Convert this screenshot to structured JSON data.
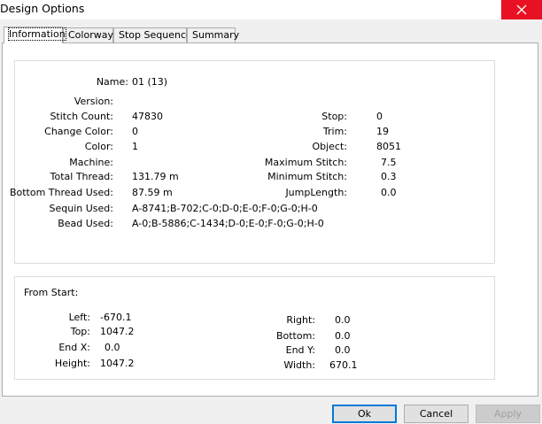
{
  "window": {
    "title": "Design Options"
  },
  "tabs": [
    "Information",
    "Colorway",
    "Stop Sequence",
    "Summary"
  ],
  "info": {
    "name_label": "Name:",
    "name": "01 (13)",
    "version_label": "Version:",
    "version": "",
    "stitch_count_label": "Stitch Count:",
    "stitch_count": "47830",
    "change_color_label": "Change Color:",
    "change_color": "0",
    "color_label": "Color:",
    "color": "1",
    "machine_label": "Machine:",
    "machine": "",
    "total_thread_label": "Total Thread:",
    "total_thread": "131.79 m",
    "bottom_thread_label": "Bottom Thread Used:",
    "bottom_thread": "87.59 m",
    "sequin_label": "Sequin Used:",
    "sequin": "A-8741;B-702;C-0;D-0;E-0;F-0;G-0;H-0",
    "bead_label": "Bead Used:",
    "bead": "A-0;B-5886;C-1434;D-0;E-0;F-0;G-0;H-0",
    "stop_label": "Stop:",
    "stop": "0",
    "trim_label": "Trim:",
    "trim": "19",
    "object_label": "Object:",
    "object": "8051",
    "max_stitch_label": "Maximum Stitch:",
    "max_stitch": "7.5",
    "min_stitch_label": "Minimum Stitch:",
    "min_stitch": "0.3",
    "jump_length_label": "JumpLength:",
    "jump_length": "0.0"
  },
  "from_start": {
    "heading": "From Start:",
    "left_label": "Left:",
    "left": "-670.1",
    "top_label": "Top:",
    "top": "1047.2",
    "end_x_label": "End X:",
    "end_x": "0.0",
    "height_label": "Height:",
    "height": "1047.2",
    "right_label": "Right:",
    "right": "0.0",
    "bottom_label": "Bottom:",
    "bottom": "0.0",
    "end_y_label": "End Y:",
    "end_y": "0.0",
    "width_label": "Width:",
    "width": "670.1"
  },
  "buttons": {
    "ok": "Ok",
    "cancel": "Cancel",
    "apply": "Apply"
  }
}
